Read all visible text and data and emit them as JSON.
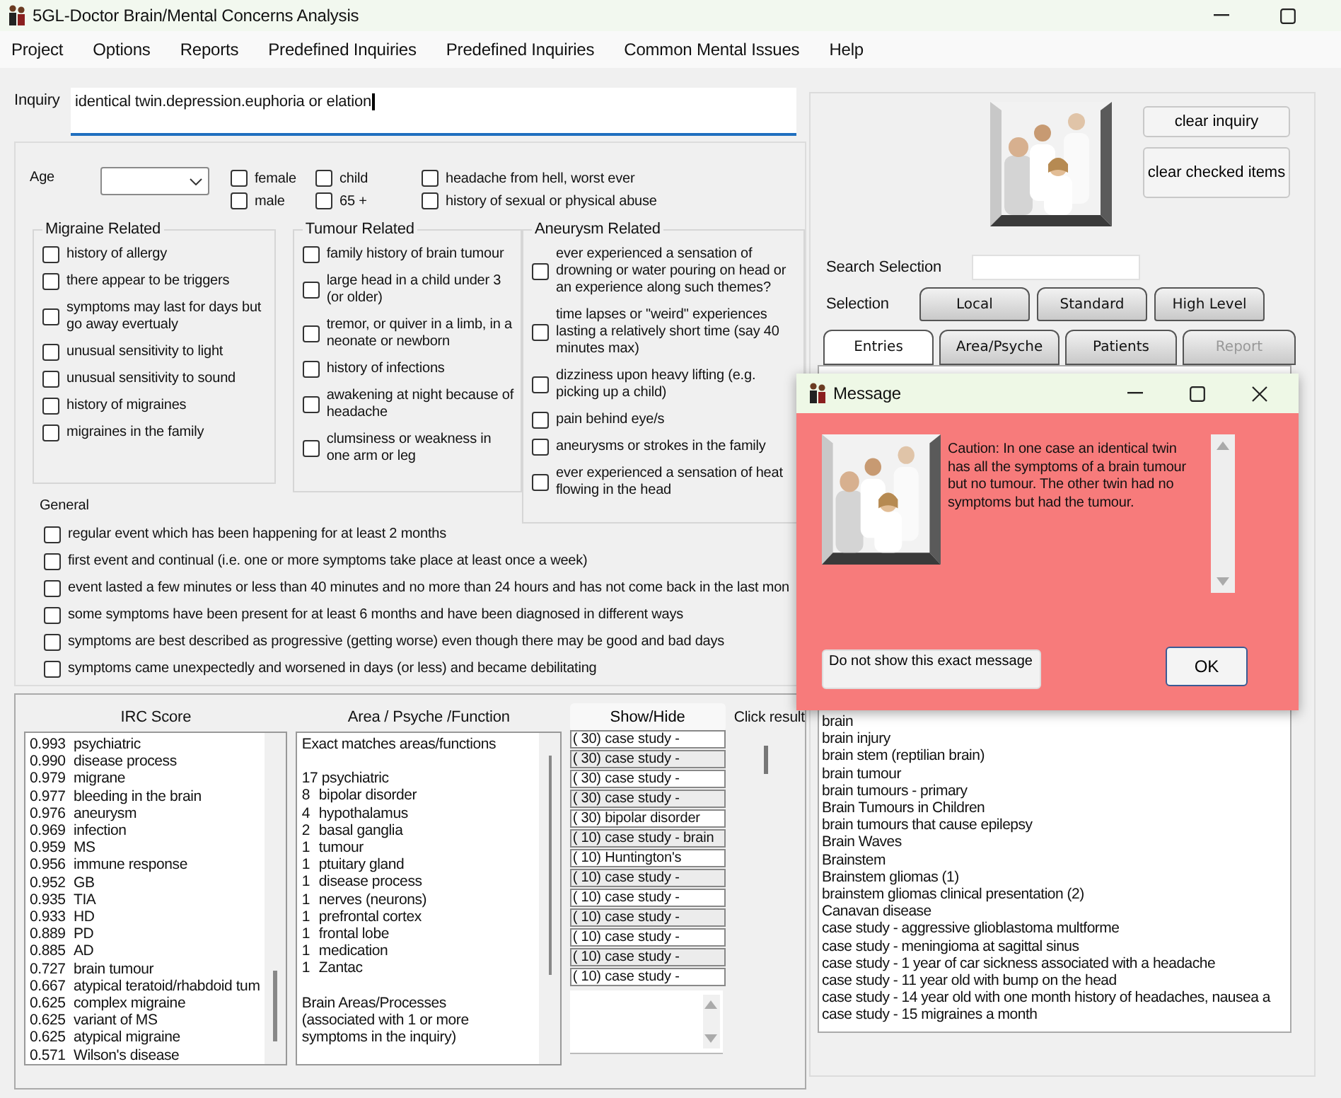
{
  "window": {
    "title": "5GL-Doctor Brain/Mental Concerns Analysis"
  },
  "menu": [
    "Project",
    "Options",
    "Reports",
    "Predefined Inquiries",
    "Predefined Inquiries",
    "Common Mental Issues",
    "Help"
  ],
  "inquiry": {
    "label": "Inquiry",
    "value": "identical twin.depression.euphoria or elation"
  },
  "options": {
    "age_label": "Age",
    "demographics": [
      {
        "label": "female",
        "checked": false
      },
      {
        "label": "male",
        "checked": false
      },
      {
        "label": "child",
        "checked": false
      },
      {
        "label": "65 +",
        "checked": false
      },
      {
        "label": "headache from hell, worst ever",
        "checked": false
      },
      {
        "label": "history of sexual or physical abuse",
        "checked": false
      }
    ],
    "groups": [
      {
        "title": "Migraine Related",
        "items": [
          {
            "label": "history of allergy",
            "checked": false
          },
          {
            "label": "there appear to be triggers",
            "checked": false
          },
          {
            "label": "symptoms may last for days but go away evertualy",
            "checked": false
          },
          {
            "label": "unusual sensitivity to light",
            "checked": false
          },
          {
            "label": "unusual sensitivity to sound",
            "checked": false
          },
          {
            "label": "history of migraines",
            "checked": false
          },
          {
            "label": "migraines in the family",
            "checked": false
          }
        ]
      },
      {
        "title": "Tumour Related",
        "items": [
          {
            "label": "family history of brain tumour",
            "checked": false
          },
          {
            "label": "large head in a child under 3 (or older)",
            "checked": false
          },
          {
            "label": "tremor, or quiver in a limb, in a neonate or newborn",
            "checked": false
          },
          {
            "label": "history of infections",
            "checked": false
          },
          {
            "label": "awakening at night because of headache",
            "checked": false
          },
          {
            "label": "clumsiness or weakness in one arm or leg",
            "checked": false
          }
        ]
      },
      {
        "title": "Aneurysm Related",
        "items": [
          {
            "label": "ever experienced a sensation of drowning or water pouring on head or an experience along such themes?",
            "checked": false
          },
          {
            "label": "time lapses or \"weird\" experiences lasting a relatively short time (say 40 minutes max)",
            "checked": false
          },
          {
            "label": "dizziness upon heavy lifting (e.g. picking up a child)",
            "checked": false
          },
          {
            "label": "pain behind eye/s",
            "checked": false
          },
          {
            "label": "aneurysms or strokes in the family",
            "checked": false
          },
          {
            "label": "ever experienced a sensation of heat flowing in the head",
            "checked": false
          }
        ]
      }
    ],
    "general": {
      "title": "General",
      "items": [
        {
          "label": "regular event which has been happening for at least 2 months",
          "checked": false
        },
        {
          "label": "first event and continual (i.e. one or more symptoms take place at least once a week)",
          "checked": false
        },
        {
          "label": "event lasted a few minutes or less than 40 minutes and no more than 24 hours and has not come back in the last mon",
          "checked": false
        },
        {
          "label": "some symptoms have been present for at least 6 months and have been diagnosed in different ways",
          "checked": false
        },
        {
          "label": "symptoms are best described as progressive (getting worse) even though there may be good and bad days",
          "checked": false
        },
        {
          "label": "symptoms came unexpectedly and worsened in days (or less) and became debilitating",
          "checked": false
        }
      ]
    }
  },
  "results": {
    "score_header": "IRC Score",
    "scores": [
      {
        "score": "0.993",
        "name": "psychiatric"
      },
      {
        "score": "0.990",
        "name": "disease process"
      },
      {
        "score": "0.979",
        "name": "migrane"
      },
      {
        "score": "0.977",
        "name": "bleeding in the brain"
      },
      {
        "score": "0.976",
        "name": "aneurysm"
      },
      {
        "score": "0.969",
        "name": "infection"
      },
      {
        "score": "0.959",
        "name": "MS"
      },
      {
        "score": "0.956",
        "name": "immune response"
      },
      {
        "score": "0.952",
        "name": "GB"
      },
      {
        "score": "0.935",
        "name": "TIA"
      },
      {
        "score": "0.933",
        "name": "HD"
      },
      {
        "score": "0.889",
        "name": "PD"
      },
      {
        "score": "0.885",
        "name": "AD"
      },
      {
        "score": "0.727",
        "name": "brain tumour"
      },
      {
        "score": "0.667",
        "name": "atypical teratoid/rhabdoid tum"
      },
      {
        "score": "0.625",
        "name": "complex migraine"
      },
      {
        "score": "0.625",
        "name": "variant of MS"
      },
      {
        "score": "0.625",
        "name": "atypical migraine"
      },
      {
        "score": "0.571",
        "name": "Wilson's disease"
      }
    ],
    "area_header": "Area / Psyche /Function",
    "area_heading": "Exact matches areas/functions",
    "matches": [
      {
        "count": "17",
        "name": "psychiatric"
      },
      {
        "count": "8",
        "name": "bipolar disorder"
      },
      {
        "count": "4",
        "name": "hypothalamus"
      },
      {
        "count": "2",
        "name": "basal ganglia"
      },
      {
        "count": "1",
        "name": "tumour"
      },
      {
        "count": "1",
        "name": "ptuitary gland"
      },
      {
        "count": "1",
        "name": "disease process"
      },
      {
        "count": "1",
        "name": "nerves (neurons)"
      },
      {
        "count": "1",
        "name": "prefrontal cortex"
      },
      {
        "count": "1",
        "name": "frontal lobe"
      },
      {
        "count": "1",
        "name": "medication"
      },
      {
        "count": "1",
        "name": "Zantac"
      }
    ],
    "area_note": "Brain Areas/Processes (associated with 1 or more symptoms in the inquiry)",
    "show_hide": "Show/Hide",
    "click_result": "Click result",
    "cases": [
      "( 30) case study -",
      "( 30) case study -",
      "( 30) case study -",
      "( 30) case study -",
      "( 30) bipolar disorder",
      "( 10) case study - brain",
      "( 10) Huntington's",
      "( 10) case study -",
      "( 10) case study -",
      "( 10) case study -",
      "( 10) case study -",
      "( 10) case study -",
      "( 10) case study -"
    ]
  },
  "right": {
    "clear_inquiry": "clear inquiry",
    "clear_checked": "clear checked items",
    "search_label": "Search Selection",
    "selection_label": "Selection",
    "selection_buttons": [
      "Local",
      "Standard",
      "High Level"
    ],
    "tabs": [
      {
        "label": "Entries",
        "selected": true,
        "disabled": false
      },
      {
        "label": "Area/Psyche",
        "selected": false,
        "disabled": false
      },
      {
        "label": "Patients",
        "selected": false,
        "disabled": false
      },
      {
        "label": "Report",
        "selected": false,
        "disabled": true
      }
    ],
    "entries": [
      "brain",
      "brain injury",
      "brain stem (reptilian brain)",
      "brain tumour",
      "brain tumours - primary",
      "Brain Tumours in Children",
      "brain tumours that cause epilepsy",
      "Brain Waves",
      "Brainstem",
      "Brainstem gliomas (1)",
      "brainstem gliomas clinical presentation (2)",
      "Canavan disease",
      "case study -  aggressive glioblastoma multforme",
      "case study -  meningioma at sagittal sinus",
      "case study - 1 year of car sickness associated with a headache",
      "case study - 11 year old with bump on the head",
      "case study - 14 year old with one month history of headaches, nausea a",
      "case study - 15 migraines a month"
    ]
  },
  "message": {
    "title": "Message",
    "text": "Caution: In one case an identical twin has all the symptoms of a brain tumour but no tumour. The other twin had no symptoms but had the tumour.",
    "dont_show": "Do not show this exact message",
    "ok": "OK"
  }
}
